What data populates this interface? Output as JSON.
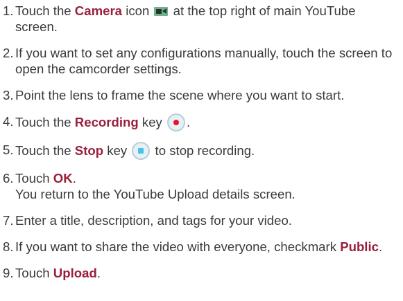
{
  "steps": [
    {
      "num": "1.",
      "parts": [
        "Touch the ",
        "Camera",
        " icon ",
        " at the top right of main YouTube screen."
      ]
    },
    {
      "num": "2.",
      "text": "If you want to set any configurations manually, touch the screen to open the camcorder settings."
    },
    {
      "num": "3.",
      "text": "Point the lens to frame the scene where you want to start."
    },
    {
      "num": "4.",
      "parts": [
        "Touch the ",
        "Recording",
        " key ",
        "."
      ]
    },
    {
      "num": "5.",
      "parts": [
        "Touch the ",
        "Stop",
        " key ",
        " to stop recording."
      ]
    },
    {
      "num": "6.",
      "parts": [
        "Touch ",
        "OK",
        "."
      ],
      "line2": "You return to the YouTube Upload details screen."
    },
    {
      "num": "7.",
      "text": "Enter a title, description, and tags for your video."
    },
    {
      "num": "8.",
      "parts": [
        "If you want to share the video with everyone, checkmark ",
        "Public",
        "."
      ]
    },
    {
      "num": "9.",
      "parts": [
        "Touch ",
        "Upload",
        "."
      ]
    }
  ],
  "icons": {
    "camera": "camcorder-icon",
    "record": "record-key-icon",
    "stop": "stop-key-icon"
  },
  "colors": {
    "text": "#3a3a3a",
    "keyword": "#9a1f3c",
    "record": "#e5142b",
    "stop": "#48c3e7",
    "camera": "#6bb48c"
  }
}
